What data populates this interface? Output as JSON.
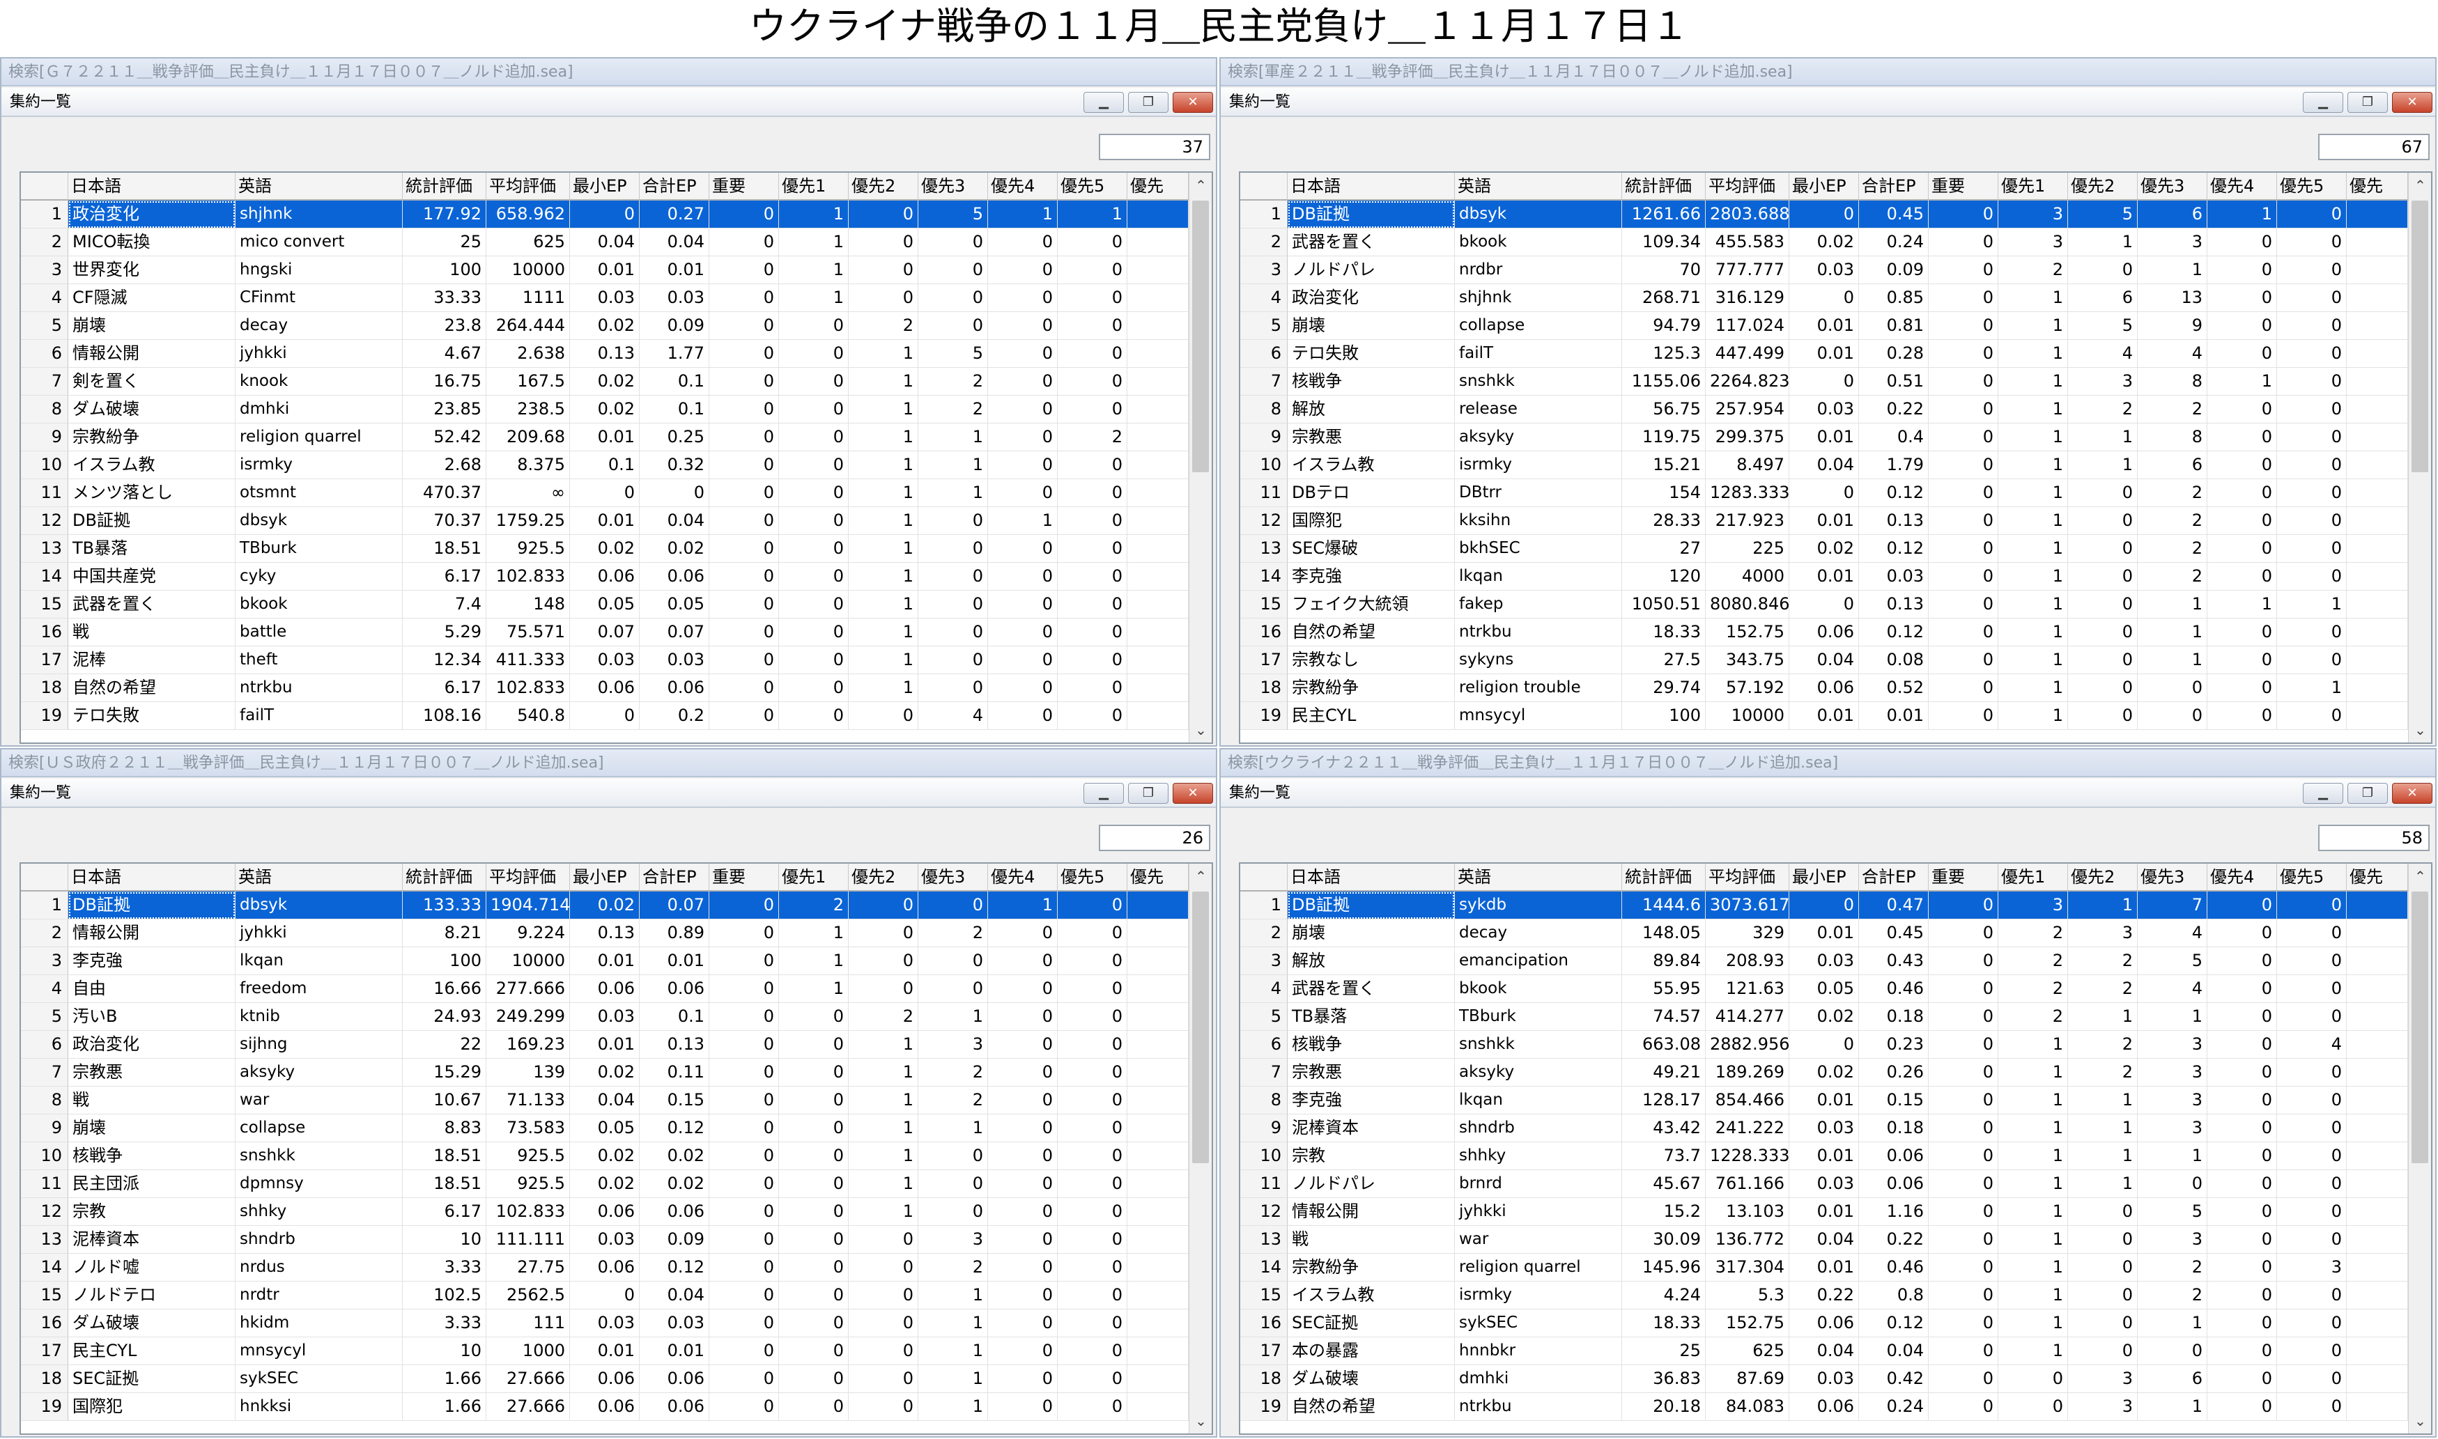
{
  "page_title": "ウクライナ戦争の１１月＿民主党負け＿１１月１７日１",
  "columns": [
    "",
    "日本語",
    "英語",
    "統計評価",
    "平均評価",
    "最小EP",
    "合計EP",
    "重要",
    "優先1",
    "優先2",
    "優先3",
    "優先4",
    "優先5",
    "優先"
  ],
  "window_title": "集約一覧",
  "icons": {
    "minimize": "minimize-icon",
    "restore": "restore-icon",
    "close": "close-icon",
    "scroll_up": "scroll-up-icon",
    "scroll_down": "scroll-down-icon"
  },
  "colors": {
    "selected_row": "#0a64d6",
    "close_button": "#c7432a"
  },
  "panes": [
    {
      "search_title": "検索[Ｇ７２２１１＿戦争評価＿民主負け＿１１月１７日００７＿ノルド追加.sea]",
      "count": "37",
      "rows": [
        [
          "1",
          "政治変化",
          "shjhnk",
          "177.92",
          "658.962",
          "0",
          "0.27",
          "0",
          "1",
          "0",
          "5",
          "1",
          "1"
        ],
        [
          "2",
          "MICO転換",
          "mico convert",
          "25",
          "625",
          "0.04",
          "0.04",
          "0",
          "1",
          "0",
          "0",
          "0",
          "0"
        ],
        [
          "3",
          "世界変化",
          "hngski",
          "100",
          "10000",
          "0.01",
          "0.01",
          "0",
          "1",
          "0",
          "0",
          "0",
          "0"
        ],
        [
          "4",
          "CF隠滅",
          "CFinmt",
          "33.33",
          "1111",
          "0.03",
          "0.03",
          "0",
          "1",
          "0",
          "0",
          "0",
          "0"
        ],
        [
          "5",
          "崩壊",
          "decay",
          "23.8",
          "264.444",
          "0.02",
          "0.09",
          "0",
          "0",
          "2",
          "0",
          "0",
          "0"
        ],
        [
          "6",
          "情報公開",
          "jyhkki",
          "4.67",
          "2.638",
          "0.13",
          "1.77",
          "0",
          "0",
          "1",
          "5",
          "0",
          "0"
        ],
        [
          "7",
          "剣を置く",
          "knook",
          "16.75",
          "167.5",
          "0.02",
          "0.1",
          "0",
          "0",
          "1",
          "2",
          "0",
          "0"
        ],
        [
          "8",
          "ダム破壊",
          "dmhki",
          "23.85",
          "238.5",
          "0.02",
          "0.1",
          "0",
          "0",
          "1",
          "2",
          "0",
          "0"
        ],
        [
          "9",
          "宗教紛争",
          "religion quarrel",
          "52.42",
          "209.68",
          "0.01",
          "0.25",
          "0",
          "0",
          "1",
          "1",
          "0",
          "2"
        ],
        [
          "10",
          "イスラム教",
          "isrmky",
          "2.68",
          "8.375",
          "0.1",
          "0.32",
          "0",
          "0",
          "1",
          "1",
          "0",
          "0"
        ],
        [
          "11",
          "メンツ落とし",
          "otsmnt",
          "470.37",
          "∞",
          "0",
          "0",
          "0",
          "0",
          "1",
          "1",
          "0",
          "0"
        ],
        [
          "12",
          "DB証拠",
          "dbsyk",
          "70.37",
          "1759.25",
          "0.01",
          "0.04",
          "0",
          "0",
          "1",
          "0",
          "1",
          "0"
        ],
        [
          "13",
          "TB暴落",
          "TBburk",
          "18.51",
          "925.5",
          "0.02",
          "0.02",
          "0",
          "0",
          "1",
          "0",
          "0",
          "0"
        ],
        [
          "14",
          "中国共産党",
          "cyky",
          "6.17",
          "102.833",
          "0.06",
          "0.06",
          "0",
          "0",
          "1",
          "0",
          "0",
          "0"
        ],
        [
          "15",
          "武器を置く",
          "bkook",
          "7.4",
          "148",
          "0.05",
          "0.05",
          "0",
          "0",
          "1",
          "0",
          "0",
          "0"
        ],
        [
          "16",
          "戦",
          "battle",
          "5.29",
          "75.571",
          "0.07",
          "0.07",
          "0",
          "0",
          "1",
          "0",
          "0",
          "0"
        ],
        [
          "17",
          "泥棒",
          "theft",
          "12.34",
          "411.333",
          "0.03",
          "0.03",
          "0",
          "0",
          "1",
          "0",
          "0",
          "0"
        ],
        [
          "18",
          "自然の希望",
          "ntrkbu",
          "6.17",
          "102.833",
          "0.06",
          "0.06",
          "0",
          "0",
          "1",
          "0",
          "0",
          "0"
        ],
        [
          "19",
          "テロ失敗",
          "failT",
          "108.16",
          "540.8",
          "0",
          "0.2",
          "0",
          "0",
          "0",
          "4",
          "0",
          "0"
        ]
      ]
    },
    {
      "search_title": "検索[軍産２２１１＿戦争評価＿民主負け＿１１月１７日００７＿ノルド追加.sea]",
      "count": "67",
      "rows": [
        [
          "1",
          "DB証拠",
          "dbsyk",
          "1261.66",
          "2803.688",
          "0",
          "0.45",
          "0",
          "3",
          "5",
          "6",
          "1",
          "0"
        ],
        [
          "2",
          "武器を置く",
          "bkook",
          "109.34",
          "455.583",
          "0.02",
          "0.24",
          "0",
          "3",
          "1",
          "3",
          "0",
          "0"
        ],
        [
          "3",
          "ノルドパレ",
          "nrdbr",
          "70",
          "777.777",
          "0.03",
          "0.09",
          "0",
          "2",
          "0",
          "1",
          "0",
          "0"
        ],
        [
          "4",
          "政治変化",
          "shjhnk",
          "268.71",
          "316.129",
          "0",
          "0.85",
          "0",
          "1",
          "6",
          "13",
          "0",
          "0"
        ],
        [
          "5",
          "崩壊",
          "collapse",
          "94.79",
          "117.024",
          "0.01",
          "0.81",
          "0",
          "1",
          "5",
          "9",
          "0",
          "0"
        ],
        [
          "6",
          "テロ失敗",
          "failT",
          "125.3",
          "447.499",
          "0.01",
          "0.28",
          "0",
          "1",
          "4",
          "4",
          "0",
          "0"
        ],
        [
          "7",
          "核戦争",
          "snshkk",
          "1155.06",
          "2264.823",
          "0",
          "0.51",
          "0",
          "1",
          "3",
          "8",
          "1",
          "0"
        ],
        [
          "8",
          "解放",
          "release",
          "56.75",
          "257.954",
          "0.03",
          "0.22",
          "0",
          "1",
          "2",
          "2",
          "0",
          "0"
        ],
        [
          "9",
          "宗教悪",
          "aksyky",
          "119.75",
          "299.375",
          "0.01",
          "0.4",
          "0",
          "1",
          "1",
          "8",
          "0",
          "0"
        ],
        [
          "10",
          "イスラム教",
          "isrmky",
          "15.21",
          "8.497",
          "0.04",
          "1.79",
          "0",
          "1",
          "1",
          "6",
          "0",
          "0"
        ],
        [
          "11",
          "DBテロ",
          "DBtrr",
          "154",
          "1283.333",
          "0",
          "0.12",
          "0",
          "1",
          "0",
          "2",
          "0",
          "0"
        ],
        [
          "12",
          "国際犯",
          "kksihn",
          "28.33",
          "217.923",
          "0.01",
          "0.13",
          "0",
          "1",
          "0",
          "2",
          "0",
          "0"
        ],
        [
          "13",
          "SEC爆破",
          "bkhSEC",
          "27",
          "225",
          "0.02",
          "0.12",
          "0",
          "1",
          "0",
          "2",
          "0",
          "0"
        ],
        [
          "14",
          "李克強",
          "lkqan",
          "120",
          "4000",
          "0.01",
          "0.03",
          "0",
          "1",
          "0",
          "2",
          "0",
          "0"
        ],
        [
          "15",
          "フェイク大統領",
          "fakep",
          "1050.51",
          "8080.846",
          "0",
          "0.13",
          "0",
          "1",
          "0",
          "1",
          "1",
          "1"
        ],
        [
          "16",
          "自然の希望",
          "ntrkbu",
          "18.33",
          "152.75",
          "0.06",
          "0.12",
          "0",
          "1",
          "0",
          "1",
          "0",
          "0"
        ],
        [
          "17",
          "宗教なし",
          "sykyns",
          "27.5",
          "343.75",
          "0.04",
          "0.08",
          "0",
          "1",
          "0",
          "1",
          "0",
          "0"
        ],
        [
          "18",
          "宗教紛争",
          "religion trouble",
          "29.74",
          "57.192",
          "0.06",
          "0.52",
          "0",
          "1",
          "0",
          "0",
          "0",
          "1"
        ],
        [
          "19",
          "民主CYL",
          "mnsycyl",
          "100",
          "10000",
          "0.01",
          "0.01",
          "0",
          "1",
          "0",
          "0",
          "0",
          "0"
        ]
      ]
    },
    {
      "search_title": "検索[ＵＳ政府２２１１＿戦争評価＿民主負け＿１１月１７日００７＿ノルド追加.sea]",
      "count": "26",
      "rows": [
        [
          "1",
          "DB証拠",
          "dbsyk",
          "133.33",
          "1904.714",
          "0.02",
          "0.07",
          "0",
          "2",
          "0",
          "0",
          "1",
          "0"
        ],
        [
          "2",
          "情報公開",
          "jyhkki",
          "8.21",
          "9.224",
          "0.13",
          "0.89",
          "0",
          "1",
          "0",
          "2",
          "0",
          "0"
        ],
        [
          "3",
          "李克強",
          "lkqan",
          "100",
          "10000",
          "0.01",
          "0.01",
          "0",
          "1",
          "0",
          "0",
          "0",
          "0"
        ],
        [
          "4",
          "自由",
          "freedom",
          "16.66",
          "277.666",
          "0.06",
          "0.06",
          "0",
          "1",
          "0",
          "0",
          "0",
          "0"
        ],
        [
          "5",
          "汚いB",
          "ktnib",
          "24.93",
          "249.299",
          "0.03",
          "0.1",
          "0",
          "0",
          "2",
          "1",
          "0",
          "0"
        ],
        [
          "6",
          "政治変化",
          "sijhng",
          "22",
          "169.23",
          "0.01",
          "0.13",
          "0",
          "0",
          "1",
          "3",
          "0",
          "0"
        ],
        [
          "7",
          "宗教悪",
          "aksyky",
          "15.29",
          "139",
          "0.02",
          "0.11",
          "0",
          "0",
          "1",
          "2",
          "0",
          "0"
        ],
        [
          "8",
          "戦",
          "war",
          "10.67",
          "71.133",
          "0.04",
          "0.15",
          "0",
          "0",
          "1",
          "2",
          "0",
          "0"
        ],
        [
          "9",
          "崩壊",
          "collapse",
          "8.83",
          "73.583",
          "0.05",
          "0.12",
          "0",
          "0",
          "1",
          "1",
          "0",
          "0"
        ],
        [
          "10",
          "核戦争",
          "snshkk",
          "18.51",
          "925.5",
          "0.02",
          "0.02",
          "0",
          "0",
          "1",
          "0",
          "0",
          "0"
        ],
        [
          "11",
          "民主団派",
          "dpmnsy",
          "18.51",
          "925.5",
          "0.02",
          "0.02",
          "0",
          "0",
          "1",
          "0",
          "0",
          "0"
        ],
        [
          "12",
          "宗教",
          "shhky",
          "6.17",
          "102.833",
          "0.06",
          "0.06",
          "0",
          "0",
          "1",
          "0",
          "0",
          "0"
        ],
        [
          "13",
          "泥棒資本",
          "shndrb",
          "10",
          "111.111",
          "0.03",
          "0.09",
          "0",
          "0",
          "0",
          "3",
          "0",
          "0"
        ],
        [
          "14",
          "ノルド嘘",
          "nrdus",
          "3.33",
          "27.75",
          "0.06",
          "0.12",
          "0",
          "0",
          "0",
          "2",
          "0",
          "0"
        ],
        [
          "15",
          "ノルドテロ",
          "nrdtr",
          "102.5",
          "2562.5",
          "0",
          "0.04",
          "0",
          "0",
          "0",
          "1",
          "0",
          "0"
        ],
        [
          "16",
          "ダム破壊",
          "hkidm",
          "3.33",
          "111",
          "0.03",
          "0.03",
          "0",
          "0",
          "0",
          "1",
          "0",
          "0"
        ],
        [
          "17",
          "民主CYL",
          "mnsycyl",
          "10",
          "1000",
          "0.01",
          "0.01",
          "0",
          "0",
          "0",
          "1",
          "0",
          "0"
        ],
        [
          "18",
          "SEC証拠",
          "sykSEC",
          "1.66",
          "27.666",
          "0.06",
          "0.06",
          "0",
          "0",
          "0",
          "1",
          "0",
          "0"
        ],
        [
          "19",
          "国際犯",
          "hnkksi",
          "1.66",
          "27.666",
          "0.06",
          "0.06",
          "0",
          "0",
          "0",
          "1",
          "0",
          "0"
        ]
      ]
    },
    {
      "search_title": "検索[ウクライナ２２１１＿戦争評価＿民主負け＿１１月１７日００７＿ノルド追加.sea]",
      "count": "58",
      "rows": [
        [
          "1",
          "DB証拠",
          "sykdb",
          "1444.6",
          "3073.617",
          "0",
          "0.47",
          "0",
          "3",
          "1",
          "7",
          "0",
          "0"
        ],
        [
          "2",
          "崩壊",
          "decay",
          "148.05",
          "329",
          "0.01",
          "0.45",
          "0",
          "2",
          "3",
          "4",
          "0",
          "0"
        ],
        [
          "3",
          "解放",
          "emancipation",
          "89.84",
          "208.93",
          "0.03",
          "0.43",
          "0",
          "2",
          "2",
          "5",
          "0",
          "0"
        ],
        [
          "4",
          "武器を置く",
          "bkook",
          "55.95",
          "121.63",
          "0.05",
          "0.46",
          "0",
          "2",
          "2",
          "4",
          "0",
          "0"
        ],
        [
          "5",
          "TB暴落",
          "TBburk",
          "74.57",
          "414.277",
          "0.02",
          "0.18",
          "0",
          "2",
          "1",
          "1",
          "0",
          "0"
        ],
        [
          "6",
          "核戦争",
          "snshkk",
          "663.08",
          "2882.956",
          "0",
          "0.23",
          "0",
          "1",
          "2",
          "3",
          "0",
          "4"
        ],
        [
          "7",
          "宗教悪",
          "aksyky",
          "49.21",
          "189.269",
          "0.02",
          "0.26",
          "0",
          "1",
          "2",
          "3",
          "0",
          "0"
        ],
        [
          "8",
          "李克強",
          "lkqan",
          "128.17",
          "854.466",
          "0.01",
          "0.15",
          "0",
          "1",
          "1",
          "3",
          "0",
          "0"
        ],
        [
          "9",
          "泥棒資本",
          "shndrb",
          "43.42",
          "241.222",
          "0.03",
          "0.18",
          "0",
          "1",
          "1",
          "3",
          "0",
          "0"
        ],
        [
          "10",
          "宗教",
          "shhky",
          "73.7",
          "1228.333",
          "0.01",
          "0.06",
          "0",
          "1",
          "1",
          "1",
          "0",
          "0"
        ],
        [
          "11",
          "ノルドパレ",
          "brnrd",
          "45.67",
          "761.166",
          "0.03",
          "0.06",
          "0",
          "1",
          "1",
          "0",
          "0",
          "0"
        ],
        [
          "12",
          "情報公開",
          "jyhkki",
          "15.2",
          "13.103",
          "0.01",
          "1.16",
          "0",
          "1",
          "0",
          "5",
          "0",
          "0"
        ],
        [
          "13",
          "戦",
          "war",
          "30.09",
          "136.772",
          "0.04",
          "0.22",
          "0",
          "1",
          "0",
          "3",
          "0",
          "0"
        ],
        [
          "14",
          "宗教紛争",
          "religion quarrel",
          "145.96",
          "317.304",
          "0.01",
          "0.46",
          "0",
          "1",
          "0",
          "2",
          "0",
          "3"
        ],
        [
          "15",
          "イスラム教",
          "isrmky",
          "4.24",
          "5.3",
          "0.22",
          "0.8",
          "0",
          "1",
          "0",
          "2",
          "0",
          "0"
        ],
        [
          "16",
          "SEC証拠",
          "sykSEC",
          "18.33",
          "152.75",
          "0.06",
          "0.12",
          "0",
          "1",
          "0",
          "1",
          "0",
          "0"
        ],
        [
          "17",
          "本の暴露",
          "hnnbkr",
          "25",
          "625",
          "0.04",
          "0.04",
          "0",
          "1",
          "0",
          "0",
          "0",
          "0"
        ],
        [
          "18",
          "ダム破壊",
          "dmhki",
          "36.83",
          "87.69",
          "0.03",
          "0.42",
          "0",
          "0",
          "3",
          "6",
          "0",
          "0"
        ],
        [
          "19",
          "自然の希望",
          "ntrkbu",
          "20.18",
          "84.083",
          "0.06",
          "0.24",
          "0",
          "0",
          "3",
          "1",
          "0",
          "0"
        ]
      ]
    }
  ]
}
